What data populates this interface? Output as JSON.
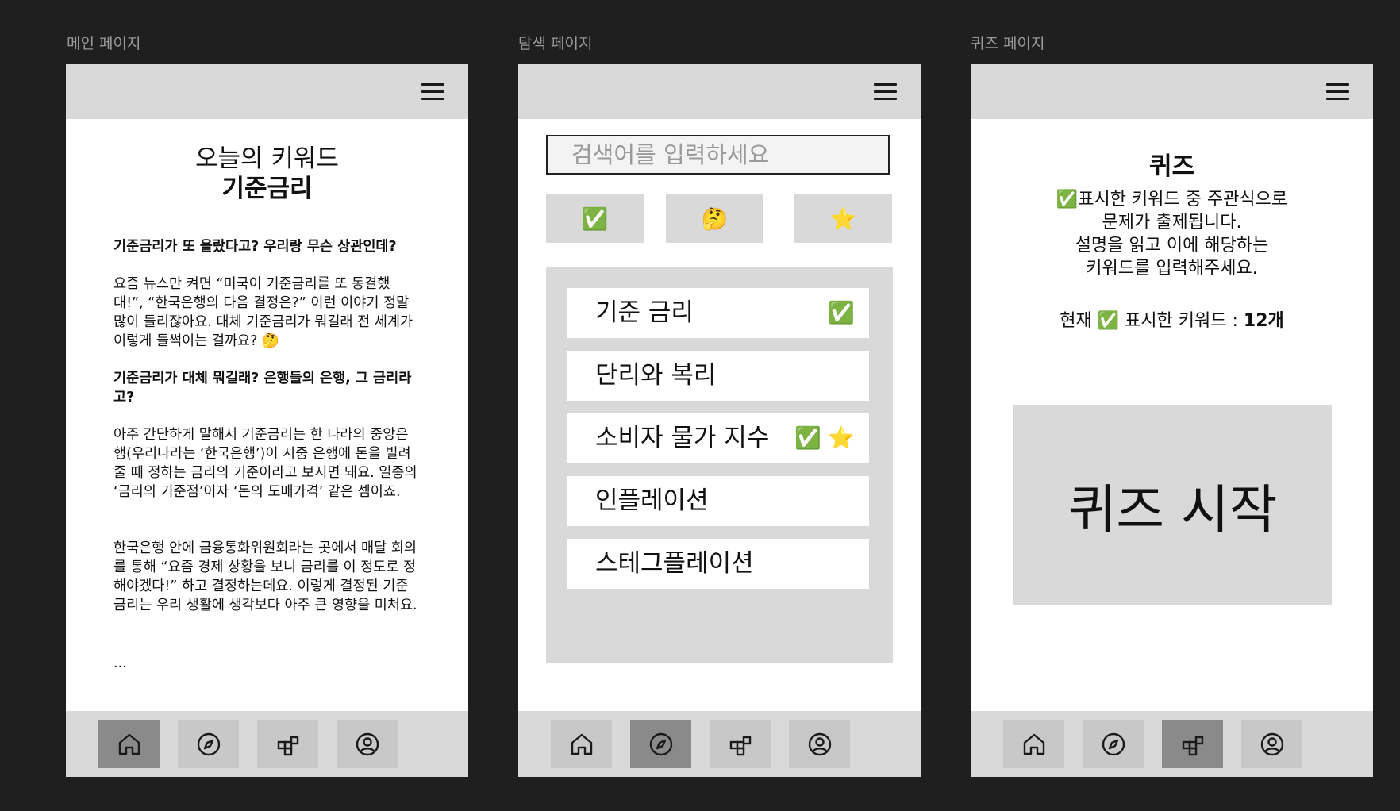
{
  "frames": {
    "main": {
      "label": "메인 페이지",
      "keyword_heading": "오늘의 키워드",
      "keyword": "기준금리",
      "sections": [
        {
          "heading": "기준금리가 또 올랐다고? 우리랑 무슨 상관인데?",
          "paragraphs": [
            "요즘 뉴스만 켜면 “미국이 기준금리를 또 동결했대!”, “한국은행의 다음 결정은?” 이런 이야기 정말 많이 들리잖아요. 대체 기준금리가 뭐길래 전 세계가 이렇게 들썩이는 걸까요? 🤔"
          ]
        },
        {
          "heading": "기준금리가 대체 뭐길래? 은행들의 은행, 그 금리라고?",
          "paragraphs": [
            "아주 간단하게 말해서 기준금리는 한 나라의 중앙은행(우리나라는 ‘한국은행’)이 시중 은행에 돈을 빌려줄 때 정하는 금리의 기준이라고 보시면 돼요. 일종의 ‘금리의 기준점’이자 ‘돈의 도매가격’ 같은 셈이죠.",
            "한국은행 안에 금융통화위원회라는 곳에서 매달 회의를 통해 “요즘 경제 상황을 보니 금리를 이 정도로 정해야겠다!” 하고 결정하는데요. 이렇게 결정된 기준금리는 우리 생활에 생각보다 아주 큰 영향을 미쳐요."
          ]
        }
      ],
      "ellipsis": "..."
    },
    "explore": {
      "label": "탐색 페이지",
      "search_placeholder": "검색어를 입력하세요",
      "filters": [
        "✅",
        "🤔",
        "⭐"
      ],
      "items": [
        {
          "name": "기준 금리",
          "marks": "✅"
        },
        {
          "name": "단리와 복리",
          "marks": ""
        },
        {
          "name": "소비자 물가 지수",
          "marks": "✅ ⭐"
        },
        {
          "name": "인플레이션",
          "marks": ""
        },
        {
          "name": "스테그플레이션",
          "marks": ""
        }
      ]
    },
    "quiz": {
      "label": "퀴즈 페이지",
      "title": "퀴즈",
      "desc_lines": [
        "✅표시한 키워드 중 주관식으로",
        "문제가 출제됩니다.",
        "설명을 읽고 이에 해당하는",
        "키워드를 입력해주세요."
      ],
      "count_prefix": "현재 ✅ 표시한 키워드 : ",
      "count_value": "12개",
      "start_label": "퀴즈 시작"
    }
  },
  "nav_icons": [
    "home-icon",
    "compass-icon",
    "blocks-icon",
    "profile-icon"
  ],
  "active_nav": {
    "main": 0,
    "explore": 1,
    "quiz": 2
  },
  "colors": {
    "background": "#1f1f1f",
    "bar": "#d9d9d9",
    "button": "#c8c8c8",
    "button_active": "#8a8a8a"
  }
}
